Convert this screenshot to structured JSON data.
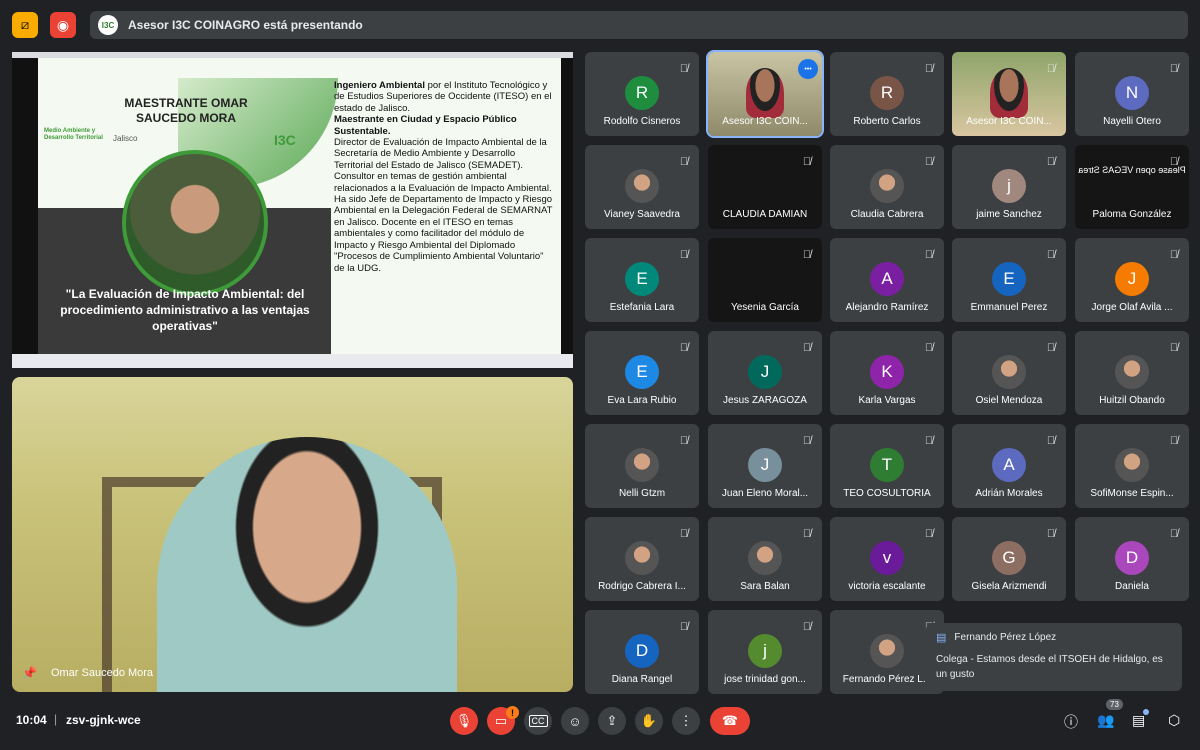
{
  "top": {
    "presenting_text": "Asesor I3C COINAGRO está presentando",
    "presenter_badge": "I3C"
  },
  "slide": {
    "heading_line1": "MAESTRANTE  OMAR",
    "heading_line2": "SAUCEDO MORA",
    "logo_left": "Medio Ambiente y Desarrollo Territorial",
    "logo_jalisco": "Jalisco",
    "logo_i3c": "I3C",
    "quote": "\"La Evaluación de Impacto Ambiental: del procedimiento administrativo a las ventajas operativas\"",
    "bio_b1": "Ingeniero Ambiental",
    "bio_t1": " por el Instituto Tecnológico y de Estudios Superiores de Occidente (ITESO) en el estado de Jalisco.",
    "bio_b2": "Maestrante en Ciudad y Espacio Público Sustentable.",
    "bio_t2": "Director de Evaluación de Impacto Ambiental de la Secretaría de Medio Ambiente y Desarrollo Territorial del Estado de Jalisco (SEMADET).",
    "bio_t3": "Consultor en temas de gestión ambiental relacionados a la Evaluación de Impacto Ambiental.",
    "bio_t4": "Ha sido Jefe de Departamento de Impacto y Riesgo Ambiental en la Delegación Federal de SEMARNAT en Jalisco. Docente en el ITESO en temas ambientales y como facilitador del módulo de Impacto y Riesgo Ambiental del Diplomado \"Procesos de Cumplimiento Ambiental Voluntario\" de la UDG."
  },
  "speaker": {
    "name": "Omar Saucedo Mora"
  },
  "participants": [
    {
      "name": "Rodolfo Cisneros",
      "initial": "R",
      "color": "#1e8e3e",
      "kind": "avatar"
    },
    {
      "name": "Asesor I3C COIN...",
      "initial": "",
      "color": "",
      "kind": "cam",
      "active": true
    },
    {
      "name": "Roberto Carlos",
      "initial": "R",
      "color": "#795548",
      "kind": "avatar"
    },
    {
      "name": "Asesor I3C COIN...",
      "initial": "",
      "color": "",
      "kind": "cam2"
    },
    {
      "name": "Nayelli Otero",
      "initial": "N",
      "color": "#5c6bc0",
      "kind": "avatar"
    },
    {
      "name": "Vianey Saavedra",
      "initial": "",
      "color": "",
      "kind": "img"
    },
    {
      "name": "CLAUDIA DAMIAN",
      "initial": "",
      "color": "",
      "kind": "dark"
    },
    {
      "name": "Claudia Cabrera",
      "initial": "",
      "color": "",
      "kind": "img"
    },
    {
      "name": "jaime Sanchez",
      "initial": "j",
      "color": "#a1887f",
      "kind": "avatar"
    },
    {
      "name": "Paloma González",
      "initial": "",
      "color": "",
      "kind": "dark",
      "mirror": "Please open VEGAS Strea"
    },
    {
      "name": "Estefania Lara",
      "initial": "E",
      "color": "#00897b",
      "kind": "avatar"
    },
    {
      "name": "Yesenia García",
      "initial": "",
      "color": "",
      "kind": "dark"
    },
    {
      "name": "Alejandro Ramírez",
      "initial": "A",
      "color": "#7b1fa2",
      "kind": "avatar"
    },
    {
      "name": "Emmanuel Perez",
      "initial": "E",
      "color": "#1565c0",
      "kind": "avatar"
    },
    {
      "name": "Jorge Olaf Avila ...",
      "initial": "J",
      "color": "#f57c00",
      "kind": "avatar"
    },
    {
      "name": "Eva Lara Rubio",
      "initial": "E",
      "color": "#1e88e5",
      "kind": "avatar"
    },
    {
      "name": "Jesus ZARAGOZA",
      "initial": "J",
      "color": "#00695c",
      "kind": "avatar"
    },
    {
      "name": "Karla Vargas",
      "initial": "K",
      "color": "#8e24aa",
      "kind": "avatar"
    },
    {
      "name": "Osiel Mendoza",
      "initial": "",
      "color": "",
      "kind": "img"
    },
    {
      "name": "Huitzil Obando",
      "initial": "",
      "color": "",
      "kind": "img"
    },
    {
      "name": "Nelli Gtzm",
      "initial": "",
      "color": "",
      "kind": "img"
    },
    {
      "name": "Juan Eleno Moral...",
      "initial": "J",
      "color": "#78909c",
      "kind": "avatar"
    },
    {
      "name": "TEO COSULTORIA",
      "initial": "T",
      "color": "#2e7d32",
      "kind": "avatar"
    },
    {
      "name": "Adrián Morales",
      "initial": "A",
      "color": "#5c6bc0",
      "kind": "avatar"
    },
    {
      "name": "SofiMonse Espin...",
      "initial": "",
      "color": "",
      "kind": "img"
    },
    {
      "name": "Rodrigo Cabrera I...",
      "initial": "",
      "color": "",
      "kind": "img"
    },
    {
      "name": "Sara Balan",
      "initial": "",
      "color": "",
      "kind": "img"
    },
    {
      "name": "victoria escalante",
      "initial": "v",
      "color": "#6a1b9a",
      "kind": "avatar"
    },
    {
      "name": "Gisela Arizmendi",
      "initial": "G",
      "color": "#8d6e63",
      "kind": "avatar"
    },
    {
      "name": "Daniela",
      "initial": "D",
      "color": "#ab47bc",
      "kind": "avatar"
    },
    {
      "name": "Diana Rangel",
      "initial": "D",
      "color": "#1565c0",
      "kind": "avatar"
    },
    {
      "name": "jose trinidad gon...",
      "initial": "j",
      "color": "#558b2f",
      "kind": "avatar"
    },
    {
      "name": "Fernando Pérez L...",
      "initial": "",
      "color": "",
      "kind": "img"
    }
  ],
  "chat": {
    "sender": "Fernando Pérez López",
    "message": "Colega - Estamos desde el ITSOEH de Hidalgo, es un gusto"
  },
  "bottom": {
    "time": "10:04",
    "separator": "|",
    "meeting_code": "zsv-gjnk-wce",
    "participant_count": "73",
    "alert_badge": "!"
  },
  "colors": {
    "background": "#202124",
    "tile": "#3c4043",
    "accent_blue": "#8ab4f8",
    "end_call_red": "#ea4335",
    "warn_orange": "#fa7b17"
  }
}
